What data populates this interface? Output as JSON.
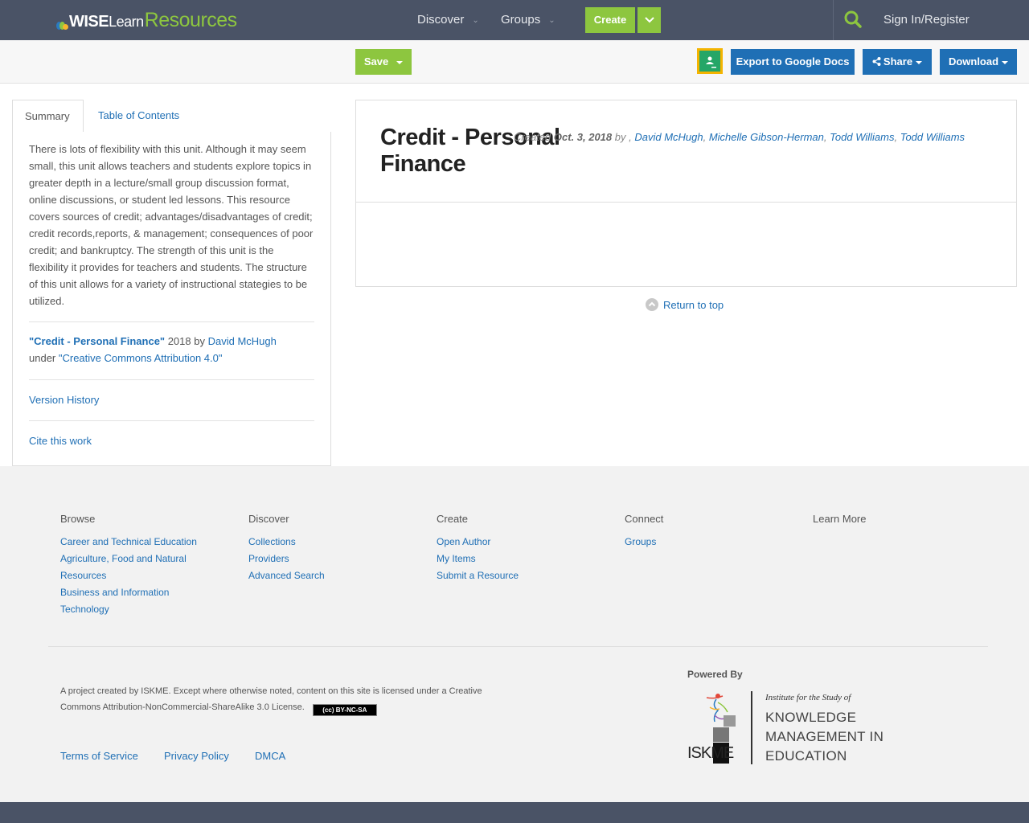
{
  "header": {
    "logo": {
      "brand_bold": "WISE",
      "brand_light": "Learn",
      "brand_accent": "Resources"
    },
    "nav": [
      {
        "label": "Discover"
      },
      {
        "label": "Groups"
      }
    ],
    "create_label": "Create",
    "signin_label": "Sign In/Register"
  },
  "toolbar": {
    "save_label": "Save",
    "export_label": "Export to Google Docs",
    "share_label": "Share",
    "download_label": "Download"
  },
  "sidebar": {
    "tabs": [
      {
        "label": "Summary",
        "active": true
      },
      {
        "label": "Table of Contents",
        "active": false
      }
    ],
    "summary": "There is lots of flexibility with this unit. Although it may seem small, this unit allows teachers and students explore topics in greater depth in a lecture/small group discussion format, online discussions, or student led lessons. This resource covers sources of credit; advantages/disadvantages of credit; credit records,reports, & management; consequences of poor credit; and bankruptcy. The strength of this unit is the flexibility it provides for teachers and students. The structure of this unit allows for a variety of instructional stategies to be utilized.",
    "attribution": {
      "work_title": "\"Credit - Personal Finance\"",
      "year_by": " 2018 by ",
      "author": "David McHugh",
      "under": "under ",
      "license": "\"Creative Commons Attribution 4.0\""
    },
    "version_history_label": "Version History",
    "cite_label": "Cite this work"
  },
  "content": {
    "title": "Credit - Personal Finance",
    "created_prefix": "Created ",
    "created_date": "Oct. 3, 2018",
    "by_text": " by , ",
    "authors": [
      "David McHugh",
      "Michelle Gibson-Herman",
      "Todd Williams",
      "Todd Williams"
    ],
    "return_top_label": "Return to top"
  },
  "footer": {
    "columns": [
      {
        "heading": "Browse",
        "links": [
          "Career and Technical Education",
          "Agriculture, Food and Natural Resources",
          "Business and Information Technology"
        ]
      },
      {
        "heading": "Discover",
        "links": [
          "Collections",
          "Providers",
          "Advanced Search"
        ]
      },
      {
        "heading": "Create",
        "links": [
          "Open Author",
          "My Items",
          "Submit a Resource"
        ]
      },
      {
        "heading": "Connect",
        "links": [
          "Groups"
        ]
      },
      {
        "heading": "Learn More",
        "links": []
      }
    ],
    "license_text": "A project created by ISKME. Except where otherwise noted, content on this site is licensed under a Creative Commons Attribution-NonCommercial-ShareAlike 3.0 License.",
    "cc_badge": "(cc) BY-NC-SA",
    "legal_links": [
      "Terms of Service",
      "Privacy Policy",
      "DMCA"
    ],
    "powered_by": "Powered By",
    "iskme": {
      "institute": "Institute for the Study of",
      "line1": "KNOWLEDGE",
      "line2": "MANAGEMENT IN",
      "line3": "EDUCATION",
      "abbr": "ISKME"
    }
  },
  "colors": {
    "nav_bg": "#4a5366",
    "green": "#8dc63f",
    "blue": "#1f6fb5",
    "footer_bg": "#f2f2f2"
  },
  "icons": [
    "search-icon",
    "chevron-down-icon",
    "share-icon",
    "google-classroom-icon",
    "arrow-up-circle-icon"
  ]
}
